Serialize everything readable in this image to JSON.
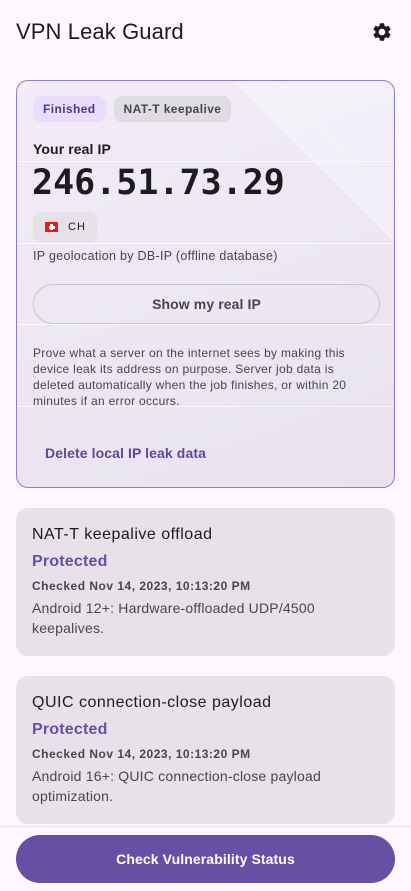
{
  "app": {
    "title": "VPN Leak Guard"
  },
  "leak_card": {
    "chips": {
      "finished": "Finished",
      "keepalive": "NAT-T keepalive"
    },
    "real_ip_label": "Your real IP",
    "ip_address": "246.51.73.29",
    "country_code": "CH",
    "geo_attribution": "IP geolocation by DB-IP (offline database)",
    "show_ip_button": "Show my real IP",
    "explanation": "Prove what a server on the internet sees by making this device leak its address on purpose. Server job data is deleted automatically when the job finishes, or within 20 minutes if an error occurs.",
    "delete_button": "Delete local IP leak data"
  },
  "status_cards": [
    {
      "title": "NAT-T keepalive offload",
      "status": "Protected",
      "checked": "Checked Nov 14, 2023, 10:13:20 PM",
      "description": "Android 12+: Hardware-offloaded UDP/4500 keepalives."
    },
    {
      "title": "QUIC connection-close payload",
      "status": "Protected",
      "checked": "Checked Nov 14, 2023, 10:13:20 PM",
      "description": "Android 16+: QUIC connection-close payload optimization."
    }
  ],
  "footer": {
    "check_button": "Check Vulnerability Status"
  },
  "icons": {
    "settings": "gear-icon",
    "flag": "swiss-flag-icon"
  },
  "colors": {
    "primary": "#6750a4",
    "card_border": "#8f7fc7",
    "chip_finished_bg": "#e8ddff"
  }
}
